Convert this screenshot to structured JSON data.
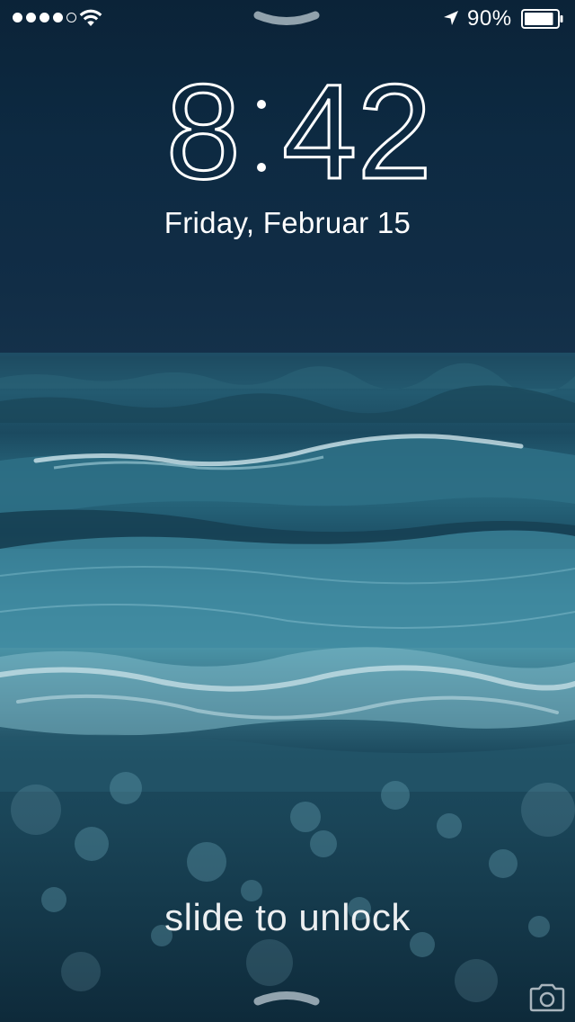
{
  "status_bar": {
    "signal_dots_filled": 4,
    "signal_dots_total": 5,
    "wifi_icon": "wifi-icon",
    "location_icon": "location-arrow-icon",
    "battery_percent_text": "90%",
    "battery_level": 0.9,
    "battery_icon": "battery-icon"
  },
  "lock_screen": {
    "time": {
      "hours": "8",
      "minutes": "42"
    },
    "date": "Friday, Februar 15",
    "unlock_label": "slide to unlock",
    "top_handle_icon": "chevron-down-handle-icon",
    "bottom_handle_icon": "chevron-up-handle-icon",
    "camera_icon": "camera-icon"
  },
  "colors": {
    "text": "#ffffff",
    "sky": "#0d2a42",
    "sea": "#2a6c82"
  }
}
